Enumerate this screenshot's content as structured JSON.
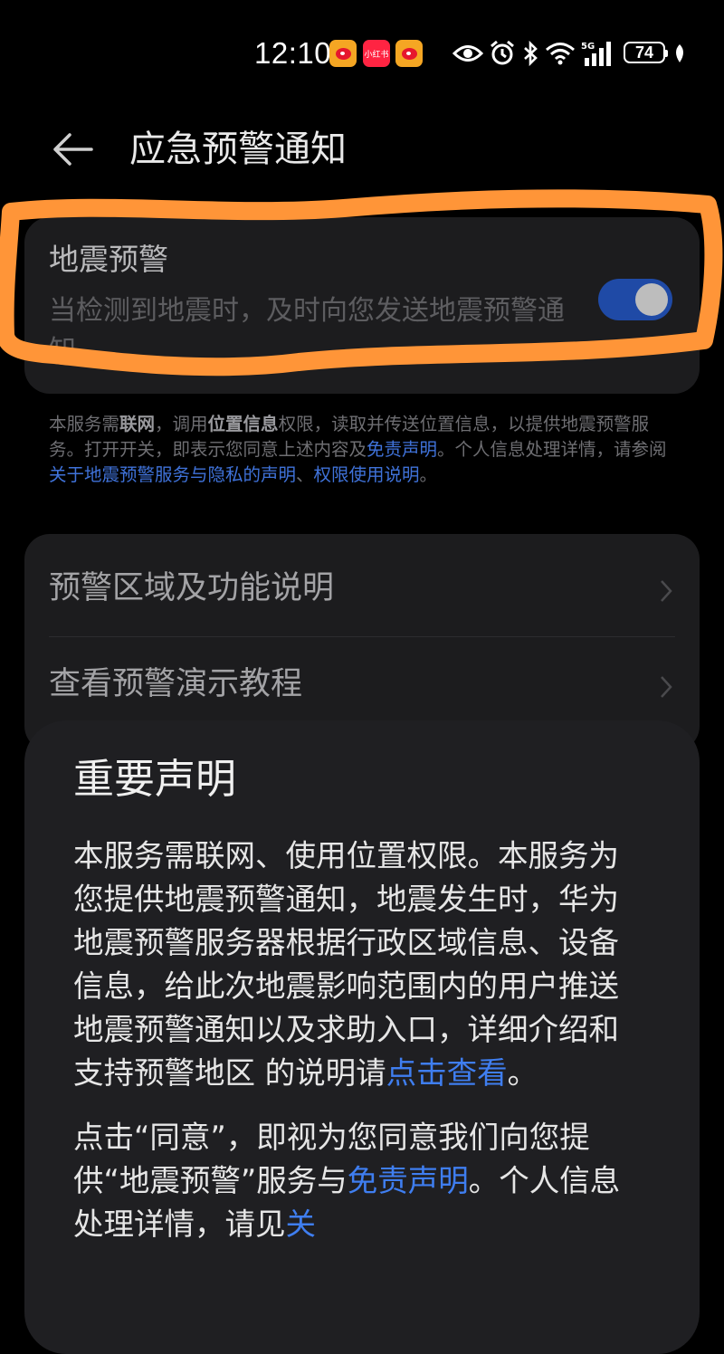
{
  "status_bar": {
    "time": "12:10",
    "apps": [
      "weibo-icon",
      "xiaohongshu-icon",
      "weibo-icon"
    ],
    "redbook_text": "小红书",
    "network": "5G",
    "battery": "74"
  },
  "header": {
    "title": "应急预警通知"
  },
  "earthquake_card": {
    "title": "地震预警",
    "description": "当检测到地震时，及时向您发送地震预警通知",
    "toggle_on": true
  },
  "notice": {
    "p1": "本服务需",
    "b1": "联网",
    "p2": "，调用",
    "b2": "位置信息",
    "p3": "权限，读取并传送位置信息，以提供地震预警服务。打开开关，即表示您同意上述内容及",
    "link1": "免责声明",
    "p4": "。个人信息处理详情，请参阅",
    "link2": "关于地震预警服务与隐私的声明",
    "p5": "、",
    "link3": "权限使用说明",
    "p6": "。"
  },
  "list": {
    "items": [
      {
        "label": "预警区域及功能说明"
      },
      {
        "label": "查看预警演示教程"
      }
    ]
  },
  "dialog": {
    "title": "重要声明",
    "para1_text": "本服务需联网、使用位置权限。本服务为您提供地震预警通知，地震发生时，华为地震预警服务器根据行政区域信息、设备信息，给此次地震影响范围内的用户推送地震预警通知以及求助入口，详细介绍和支持预警地区 的说明请",
    "para1_link": "点击查看",
    "para1_end": "。",
    "para2_text": "点击“同意”，即视为您同意我们向您提供“地震预警”服务与",
    "para2_link1": "免责声明",
    "para2_text2": "。个人信息处理详情，请见",
    "para2_link2": "关"
  },
  "colors": {
    "accent": "#3f7ef0",
    "toggle": "#1f4aa6",
    "highlight": "#ff9538",
    "card": "#1c1c1e"
  }
}
